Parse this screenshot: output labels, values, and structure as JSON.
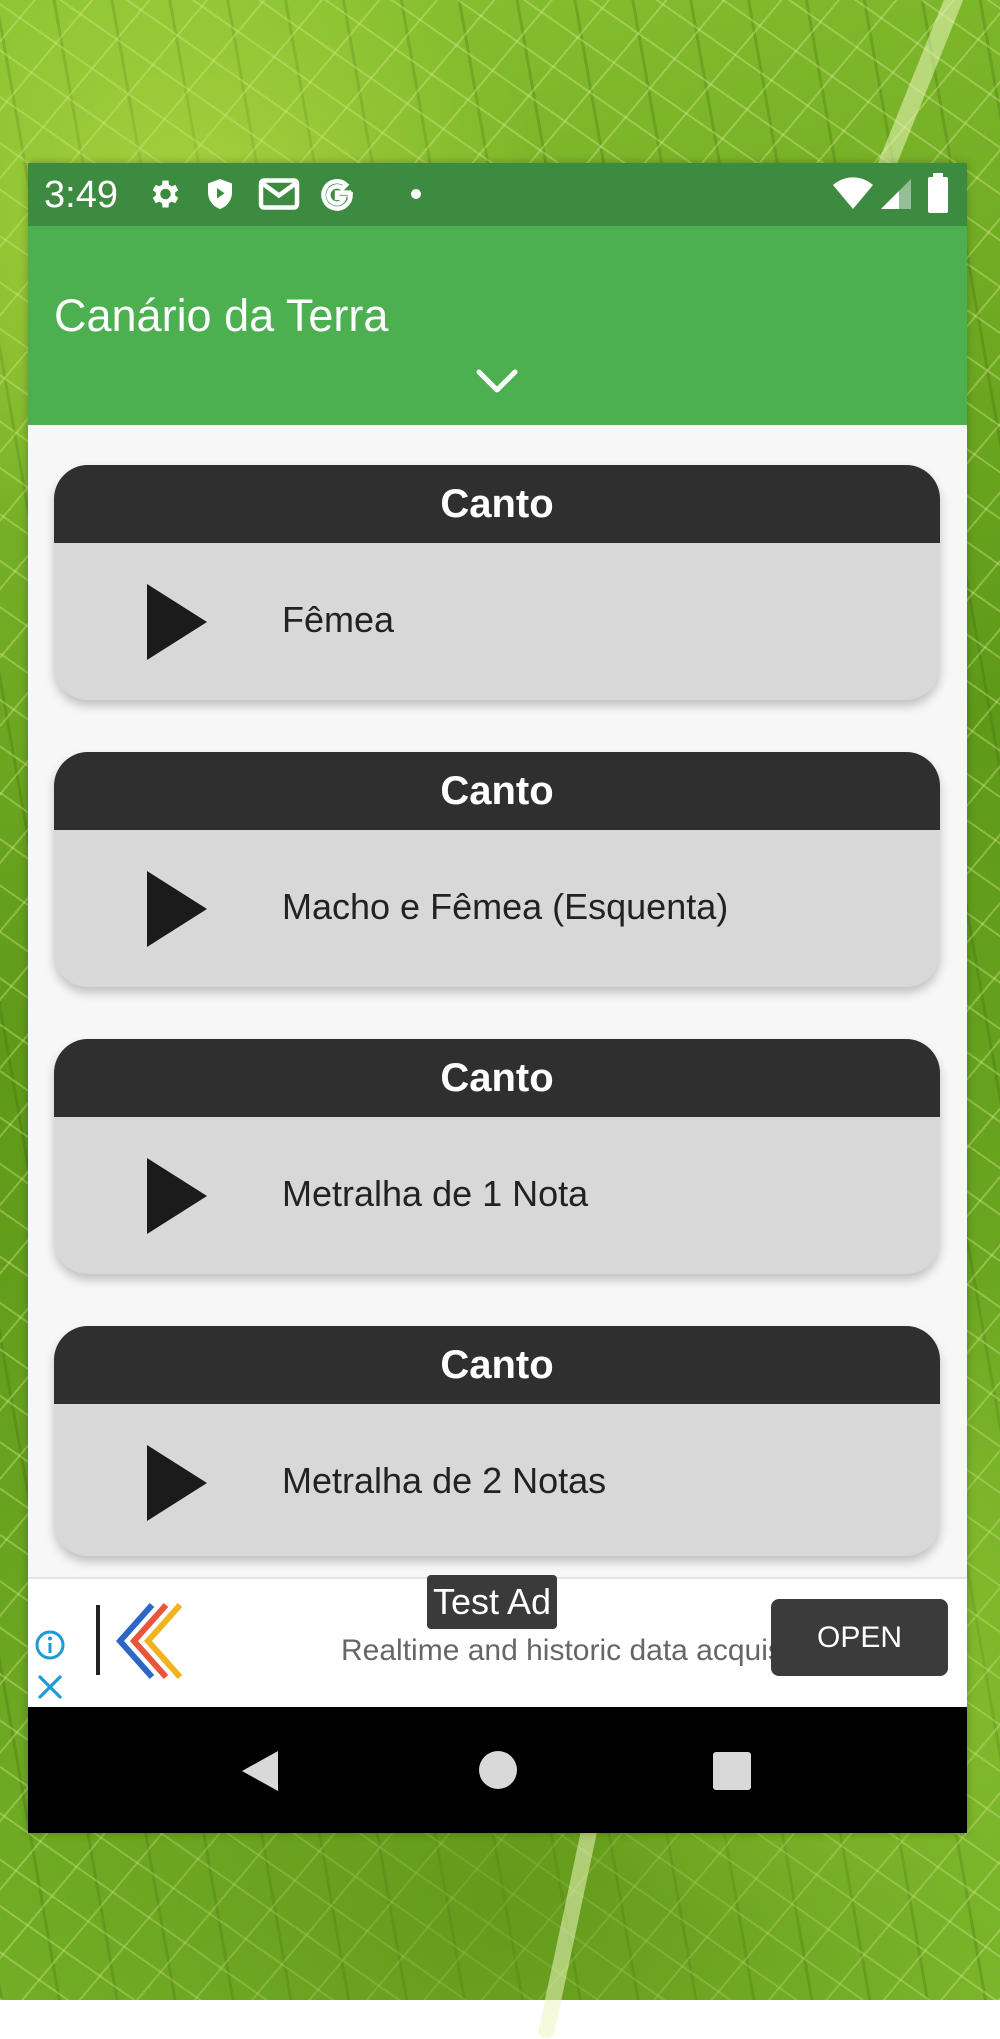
{
  "status_bar": {
    "time": "3:49",
    "left_icons": [
      "gear-icon",
      "shield-play-icon",
      "gmail-icon",
      "google-icon",
      "dot-icon"
    ],
    "right_icons": [
      "wifi-icon",
      "signal-icon",
      "battery-icon"
    ]
  },
  "app_bar": {
    "title": "Canário da Terra",
    "expand_icon": "chevron-down-icon",
    "color": "#4caf50",
    "status_color": "#3d8b40"
  },
  "cards": [
    {
      "header": "Canto",
      "label": "Fêmea"
    },
    {
      "header": "Canto",
      "label": "Macho e Fêmea (Esquenta)"
    },
    {
      "header": "Canto",
      "label": "Metralha de 1 Nota"
    },
    {
      "header": "Canto",
      "label": "Metralha de 2 Notas"
    }
  ],
  "ad": {
    "badge": "Test Ad",
    "text": "Realtime and historic data acquisition",
    "button": "OPEN"
  },
  "nav_bar": {
    "buttons": [
      "back-icon",
      "home-icon",
      "recents-icon"
    ]
  }
}
